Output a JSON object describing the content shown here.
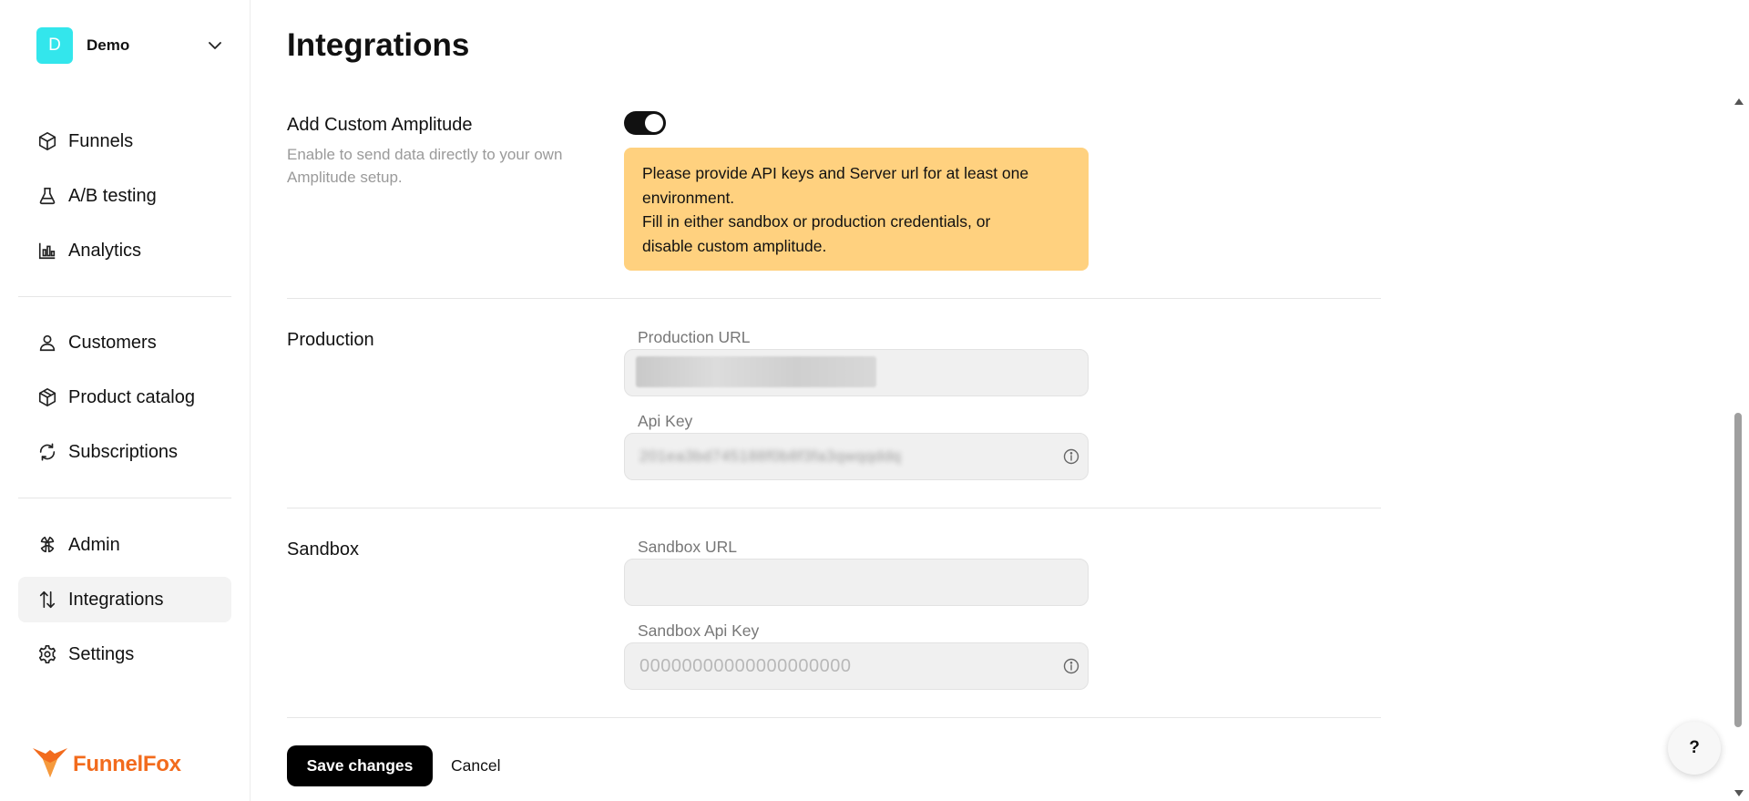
{
  "workspace": {
    "initial": "D",
    "name": "Demo"
  },
  "sidebar": {
    "items": [
      {
        "label": "Funnels",
        "icon": "cube-icon"
      },
      {
        "label": "A/B testing",
        "icon": "flask-icon"
      },
      {
        "label": "Analytics",
        "icon": "bar-chart-icon"
      },
      {
        "label": "Customers",
        "icon": "user-icon"
      },
      {
        "label": "Product catalog",
        "icon": "box-icon"
      },
      {
        "label": "Subscriptions",
        "icon": "refresh-icon"
      },
      {
        "label": "Admin",
        "icon": "admin-icon"
      },
      {
        "label": "Integrations",
        "icon": "arrows-up-down-icon",
        "active": true
      },
      {
        "label": "Settings",
        "icon": "gear-icon"
      }
    ]
  },
  "brand": {
    "name": "FunnelFox",
    "color": "#f26b1d"
  },
  "page": {
    "title": "Integrations"
  },
  "amplitude": {
    "label": "Add Custom Amplitude",
    "description": "Enable to send data directly to your own Amplitude setup.",
    "enabled": true,
    "warning": {
      "line1": "Please provide API keys and Server url for at least one",
      "line2": "environment.",
      "line3": "Fill in either sandbox or production credentials, or",
      "line4": "disable custom amplitude.",
      "color": "#ffd17f"
    }
  },
  "production": {
    "label": "Production",
    "url_label": "Production URL",
    "api_key_label": "Api Key",
    "api_key_value": "201ea3bd745188f0b8f3fa3qwqqddq"
  },
  "sandbox": {
    "label": "Sandbox",
    "url_label": "Sandbox URL",
    "url_value": "",
    "api_key_label": "Sandbox Api Key",
    "api_key_placeholder": "00000000000000000000"
  },
  "actions": {
    "save": "Save changes",
    "cancel": "Cancel"
  },
  "help": {
    "label": "?"
  }
}
